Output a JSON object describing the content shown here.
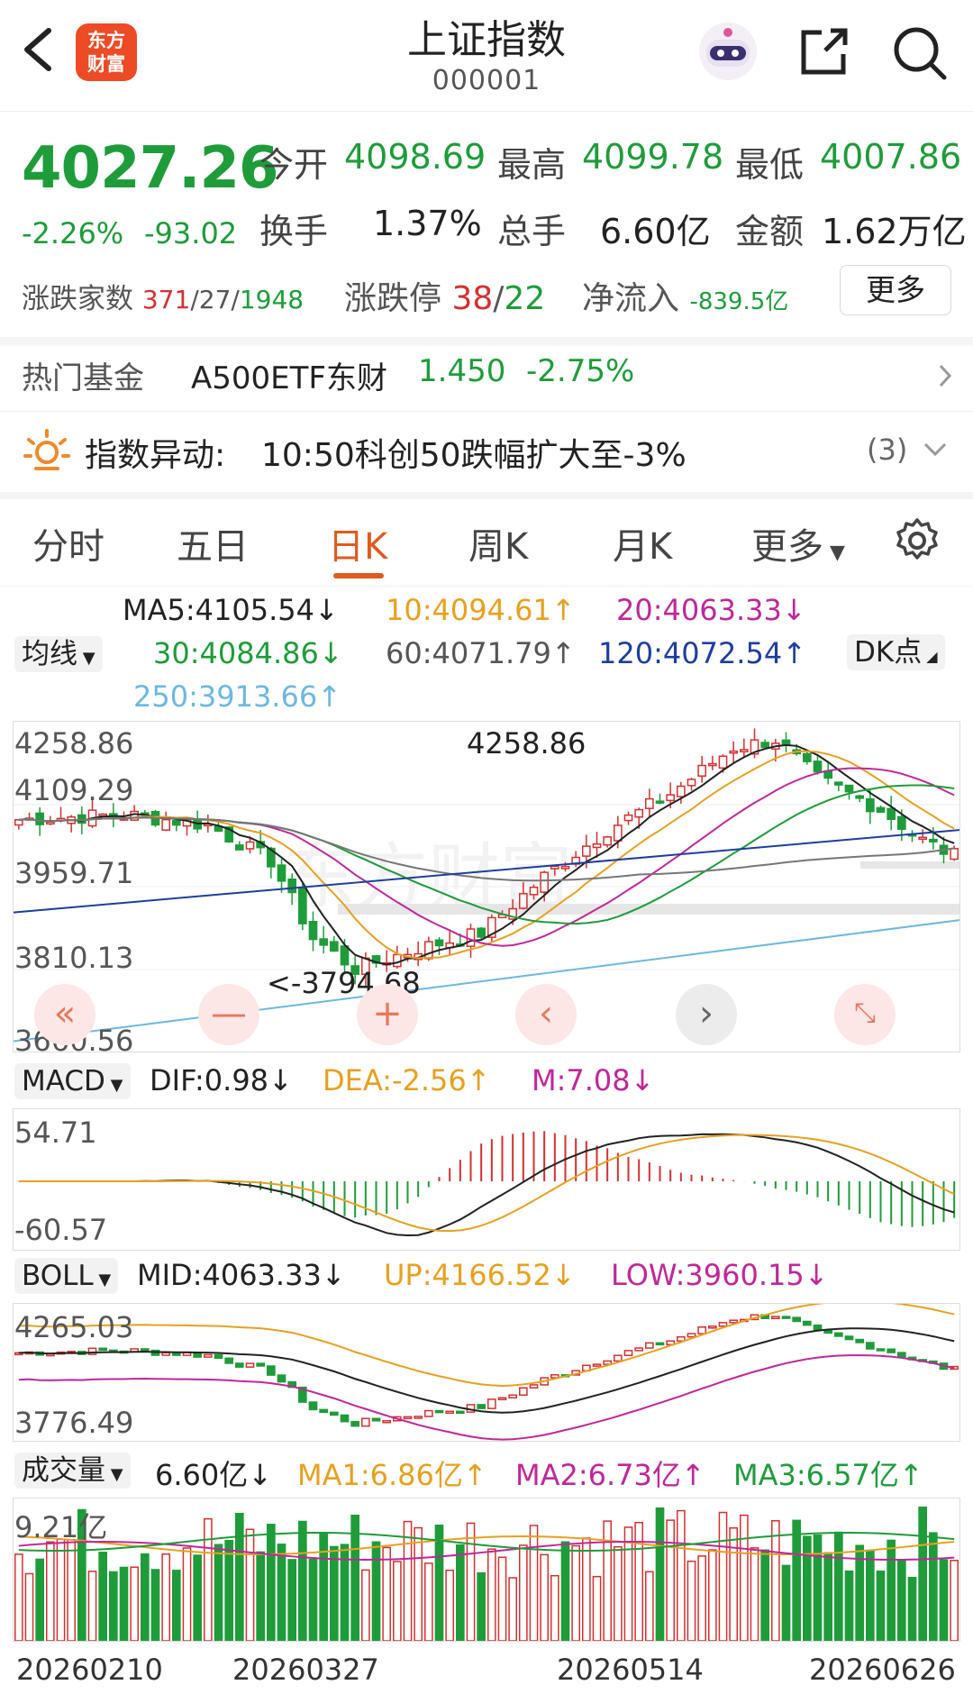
{
  "header": {
    "title": "上证指数",
    "code": "000001",
    "logo_line1": "东方",
    "logo_line2": "财富"
  },
  "quote": {
    "price": "4027.26",
    "change_pct": "-2.26%",
    "change_abs": "-93.02",
    "open_label": "今开",
    "open": "4098.69",
    "high_label": "最高",
    "high": "4099.78",
    "low_label": "最低",
    "low": "4007.86",
    "turnover_label": "换手",
    "turnover": "1.37%",
    "volume_label": "总手",
    "volume": "6.60亿",
    "amount_label": "金额",
    "amount": "1.62万亿",
    "updown_label": "涨跌家数",
    "up_count": "371",
    "flat_count": "27",
    "down_count": "1948",
    "limit_label": "涨跌停",
    "limit_up": "38",
    "limit_down": "22",
    "netflow_label": "净流入",
    "netflow": "-839.5亿",
    "more": "更多"
  },
  "fund": {
    "label": "热门基金",
    "name": "A500ETF东财",
    "price": "1.450",
    "change": "-2.75%"
  },
  "alert": {
    "label": "指数异动:",
    "text": "10:50科创50跌幅扩大至-3%",
    "count": "(3)"
  },
  "tabs": [
    "分时",
    "五日",
    "日K",
    "周K",
    "月K",
    "更多"
  ],
  "ma": {
    "selector": "均线",
    "dk": "DK点",
    "ma5": "MA5:4105.54↓",
    "ma10": "10:4094.61↑",
    "ma20": "20:4063.33↓",
    "ma30": "30:4084.86↓",
    "ma60": "60:4071.79↑",
    "ma120": "120:4072.54↑",
    "ma250": "250:3913.66↑"
  },
  "kline": {
    "y_top": "4258.86",
    "y_mid1": "4109.29",
    "y_mid2": "3959.71",
    "y_mid3": "3810.13",
    "y_bot": "3660.56",
    "high_mark": "4258.86",
    "low_mark": "<-3794.68"
  },
  "macd": {
    "selector": "MACD",
    "dif": "DIF:0.98↓",
    "dea": "DEA:-2.56↑",
    "m": "M:7.08↓",
    "y_top": "54.71",
    "y_bot": "-60.57"
  },
  "boll": {
    "selector": "BOLL",
    "mid": "MID:4063.33↓",
    "up": "UP:4166.52↓",
    "low": "LOW:3960.15↓",
    "y_top": "4265.03",
    "y_bot": "3776.49"
  },
  "vol": {
    "selector": "成交量",
    "value": "6.60亿↓",
    "ma1": "MA1:6.86亿↑",
    "ma2": "MA2:6.73亿↑",
    "ma3": "MA3:6.57亿↑",
    "y_top": "9.21亿"
  },
  "dates": [
    "20260210",
    "20260327",
    "20260514",
    "20260626"
  ],
  "colors": {
    "up": "#d43030",
    "down": "#1e9c3a",
    "accent": "#e05a20"
  }
}
